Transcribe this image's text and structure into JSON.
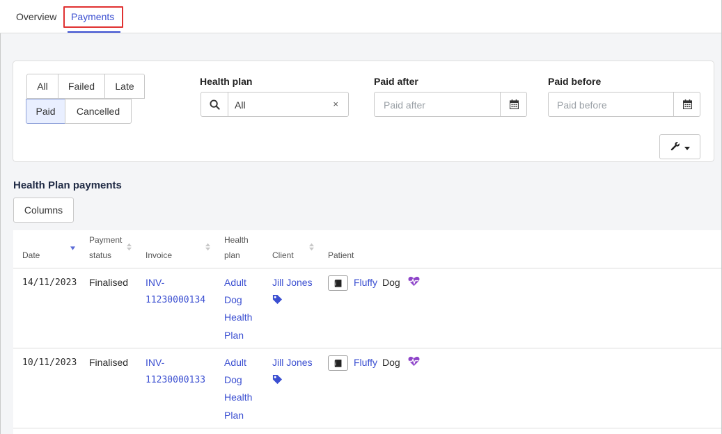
{
  "tabs": [
    {
      "label": "Overview",
      "active": false
    },
    {
      "label": "Payments",
      "active": true
    }
  ],
  "filters": {
    "status_buttons": [
      {
        "label": "All",
        "active": false
      },
      {
        "label": "Failed",
        "active": false
      },
      {
        "label": "Late",
        "active": false
      },
      {
        "label": "Paid",
        "active": true
      },
      {
        "label": "Cancelled",
        "active": false
      }
    ],
    "health_plan": {
      "label": "Health plan",
      "value": "All",
      "clear": "×"
    },
    "paid_after": {
      "label": "Paid after",
      "placeholder": "Paid after"
    },
    "paid_before": {
      "label": "Paid before",
      "placeholder": "Paid before"
    }
  },
  "section": {
    "title": "Health Plan payments",
    "columns_label": "Columns"
  },
  "table": {
    "headers": {
      "date": "Date",
      "payment_status_1": "Payment",
      "payment_status_2": "status",
      "invoice": "Invoice",
      "health_plan_1": "Health",
      "health_plan_2": "plan",
      "client": "Client",
      "patient": "Patient"
    },
    "rows": [
      {
        "date": "14/11/2023",
        "status": "Finalised",
        "invoice_1": "INV-",
        "invoice_2": "11230000134",
        "plan_1": "Adult",
        "plan_2": "Dog",
        "plan_3": "Health",
        "plan_4": "Plan",
        "client": "Jill Jones",
        "patient_name": "Fluffy",
        "patient_species": "Dog"
      },
      {
        "date": "10/11/2023",
        "status": "Finalised",
        "invoice_1": "INV-",
        "invoice_2": "11230000133",
        "plan_1": "Adult",
        "plan_2": "Dog",
        "plan_3": "Health",
        "plan_4": "Plan",
        "client": "Jill Jones",
        "patient_name": "Fluffy",
        "patient_species": "Dog"
      }
    ]
  },
  "colors": {
    "accent": "#3b4fd1",
    "highlight": "#e03131",
    "heart": "#8e44c9",
    "tag": "#3b4fd1"
  }
}
